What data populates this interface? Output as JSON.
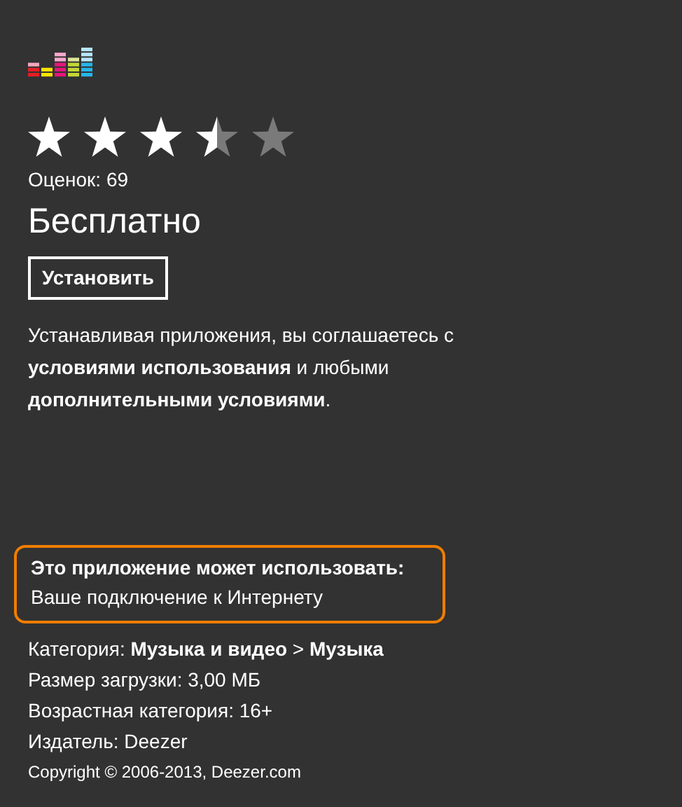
{
  "rating": {
    "stars": 3.5,
    "count_label": "Оценок: 69"
  },
  "price": "Бесплатно",
  "install_button": "Установить",
  "terms": "Устанавливая приложения, вы соглашаетесь с **условиями использования** и любыми **дополнительными условиями**.",
  "permissions": {
    "title": "Это приложение может использовать:",
    "items": [
      "Ваше подключение к Интернету"
    ]
  },
  "details": [
    "Категория: **Музыка и видео** > **Музыка**",
    "Размер загрузки: 3,00 МБ",
    "Возрастная категория: 16+",
    "Издатель: Deezer"
  ],
  "copyright": "Copyright © 2006-2013, Deezer.com"
}
